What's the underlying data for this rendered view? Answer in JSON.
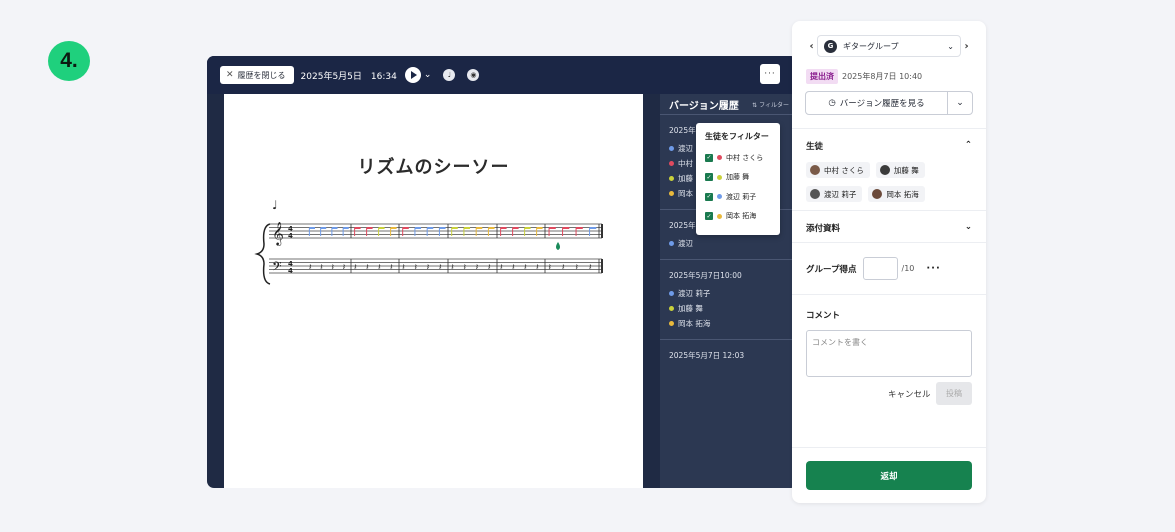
{
  "step_number": "4.",
  "topbar": {
    "close_history_label": "履歴を閉じる",
    "date_time": "2025年5月5日　16:34"
  },
  "score": {
    "title": "リズムのシーソー",
    "time_signature": {
      "top": "4",
      "bottom": "4"
    }
  },
  "history": {
    "title": "バージョン履歴",
    "filter_label": "フィルター",
    "groups": [
      {
        "date": "2025年5",
        "users": [
          {
            "name": "渡辺",
            "color": "#6f9be8"
          },
          {
            "name": "中村",
            "color": "#e04a5f"
          },
          {
            "name": "加藤",
            "color": "#c9d13b"
          },
          {
            "name": "岡本",
            "color": "#e9b93c"
          }
        ]
      },
      {
        "date": "2025年5",
        "users": [
          {
            "name": "渡辺",
            "color": "#6f9be8"
          }
        ]
      },
      {
        "date": "2025年5月7日10:00",
        "users": [
          {
            "name": "渡辺 莉子",
            "color": "#6f9be8"
          },
          {
            "name": "加藤 舞",
            "color": "#c9d13b"
          },
          {
            "name": "岡本 拓海",
            "color": "#e9b93c"
          }
        ]
      },
      {
        "date": "2025年5月7日 12:03",
        "users": []
      }
    ]
  },
  "filter_popover": {
    "title": "生徒をフィルター",
    "items": [
      {
        "name": "中村 さくら",
        "color": "#e04a5f"
      },
      {
        "name": "加藤 舞",
        "color": "#c9d13b"
      },
      {
        "name": "渡辺 莉子",
        "color": "#6f9be8"
      },
      {
        "name": "岡本 拓海",
        "color": "#e9b93c"
      }
    ]
  },
  "panel": {
    "group_name": "ギターグループ",
    "group_initial": "G",
    "status_badge": "提出済",
    "submitted_at": "2025年8月7日 10:40",
    "version_button": "バージョン履歴を見る",
    "students_title": "生徒",
    "students": [
      "中村 さくら",
      "加藤 舞",
      "渡辺 莉子",
      "岡本 拓海"
    ],
    "attachments_title": "添付資料",
    "group_score_label": "グループ得点",
    "group_score_max": "/10",
    "comment_title": "コメント",
    "comment_placeholder": "コメントを書く",
    "cancel_label": "キャンセル",
    "post_label": "投稿",
    "return_label": "返却"
  },
  "colors": {
    "accent_green": "#16824f",
    "badge_green": "#1fd07d",
    "app_bg": "#1f2a44"
  }
}
